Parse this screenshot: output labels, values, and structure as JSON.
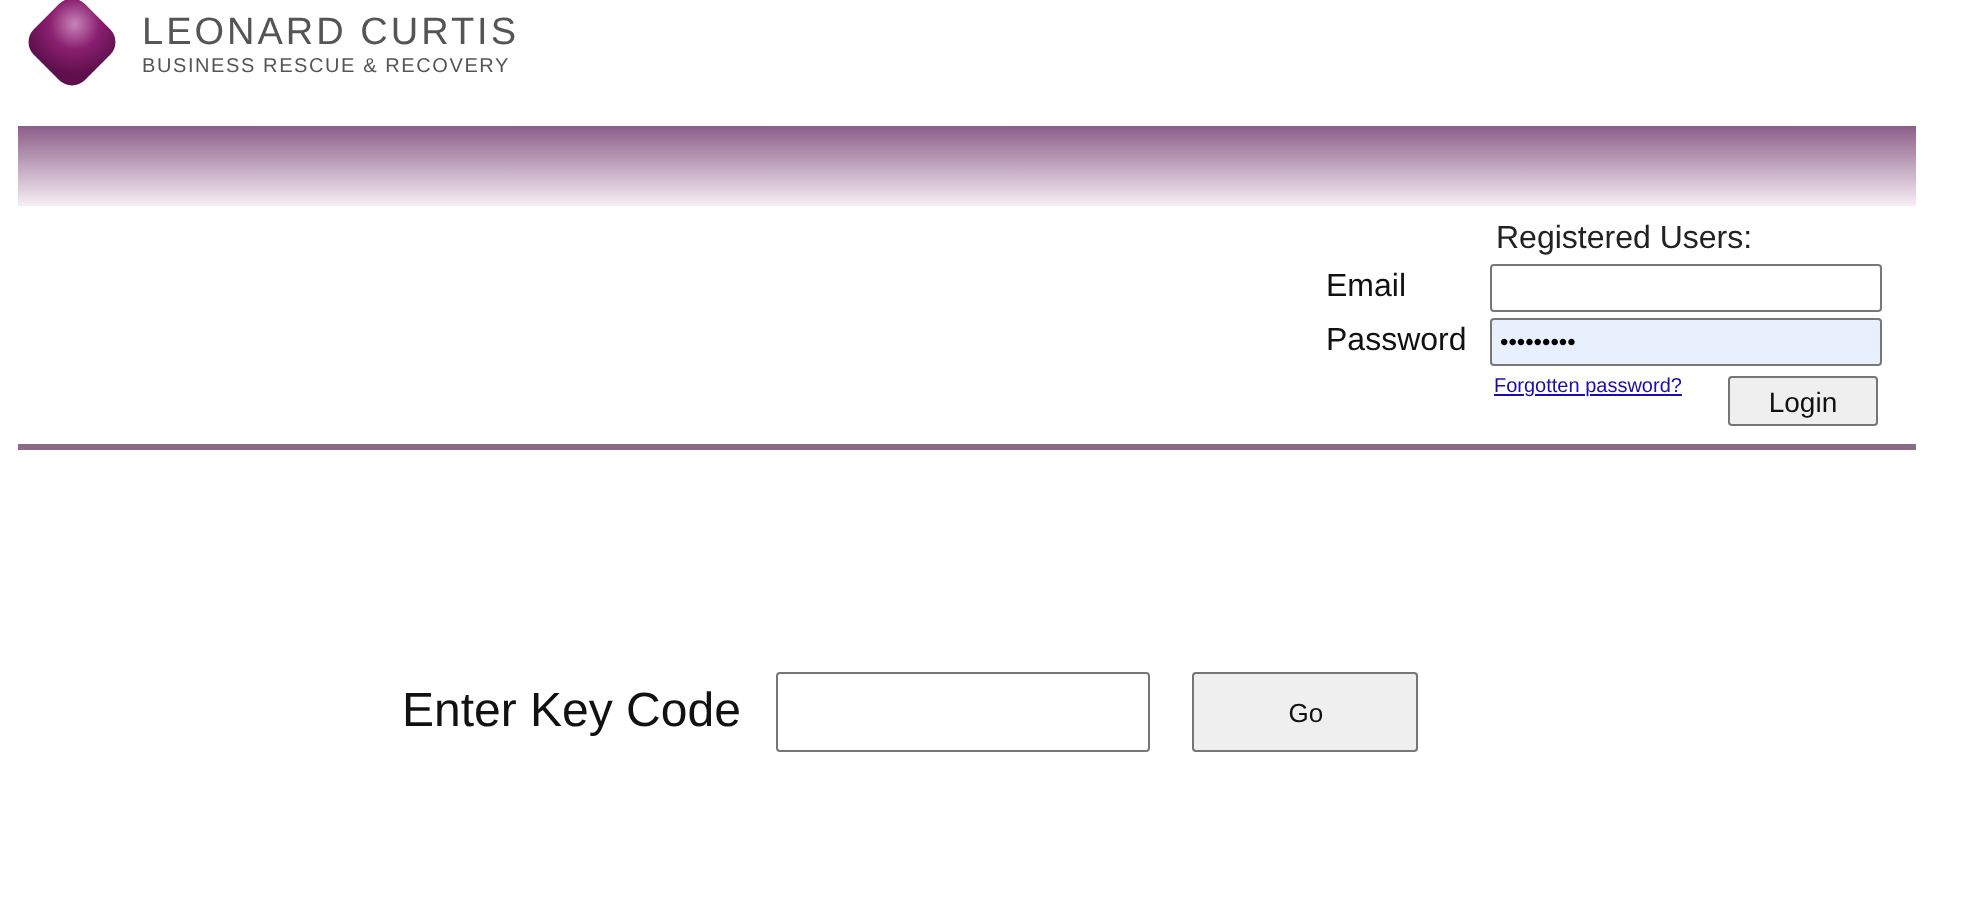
{
  "logo": {
    "name": "LEONARD CURTIS",
    "tagline": "BUSINESS RESCUE & RECOVERY"
  },
  "login": {
    "heading": "Registered Users:",
    "email_label": "Email",
    "password_label": "Password",
    "password_value": "•••••••••",
    "forgot_link": "Forgotten password?",
    "button": "Login"
  },
  "key_code": {
    "label": "Enter Key Code",
    "button": "Go"
  }
}
